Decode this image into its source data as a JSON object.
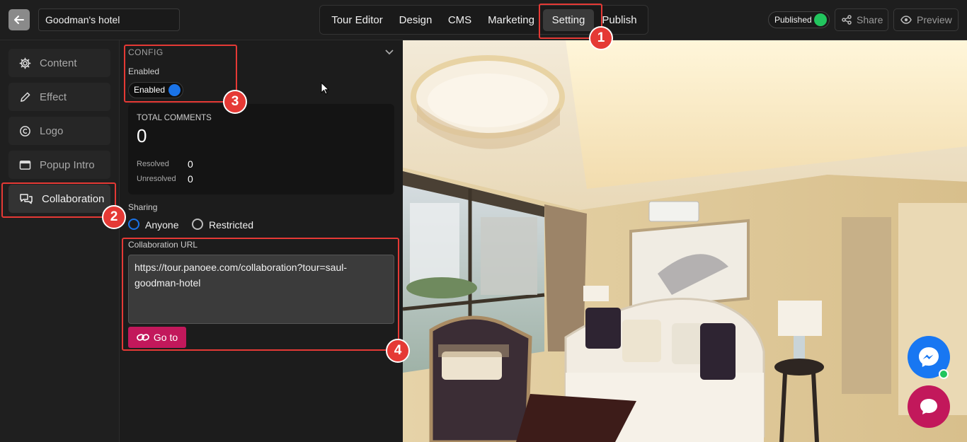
{
  "header": {
    "tour_title": "Goodman's hotel",
    "tabs": [
      {
        "label": "Tour Editor"
      },
      {
        "label": "Design"
      },
      {
        "label": "CMS"
      },
      {
        "label": "Marketing"
      },
      {
        "label": "Setting"
      },
      {
        "label": "Publish"
      }
    ],
    "active_tab": "Setting",
    "status": "Published",
    "share_label": "Share",
    "preview_label": "Preview"
  },
  "sidebar": {
    "items": [
      {
        "label": "Content",
        "icon": "gear-icon"
      },
      {
        "label": "Effect",
        "icon": "pencil-icon"
      },
      {
        "label": "Logo",
        "icon": "copyright-icon"
      },
      {
        "label": "Popup Intro",
        "icon": "window-icon"
      },
      {
        "label": "Collaboration",
        "icon": "chat-bubbles-icon"
      }
    ],
    "active_item": "Collaboration"
  },
  "config": {
    "section_title": "CONFIG",
    "enabled_label": "Enabled",
    "toggle_label": "Enabled",
    "enabled": true,
    "stats": {
      "total_label": "TOTAL COMMENTS",
      "total": "0",
      "resolved_label": "Resolved",
      "resolved": "0",
      "unresolved_label": "Unresolved",
      "unresolved": "0"
    },
    "sharing_label": "Sharing",
    "sharing_options": [
      "Anyone",
      "Restricted"
    ],
    "sharing_selected": "Anyone",
    "url_label": "Collaboration URL",
    "url_value": "https://tour.panoee.com/collaboration?tour=saul-goodman-hotel",
    "goto_label": "Go to"
  },
  "annotations": [
    "1",
    "2",
    "3",
    "4"
  ],
  "colors": {
    "accent_red": "#e53935",
    "goto_button": "#c2185b",
    "toggle_blue": "#1a73e8",
    "published_green": "#22c55e",
    "messenger_blue": "#1877f2"
  }
}
